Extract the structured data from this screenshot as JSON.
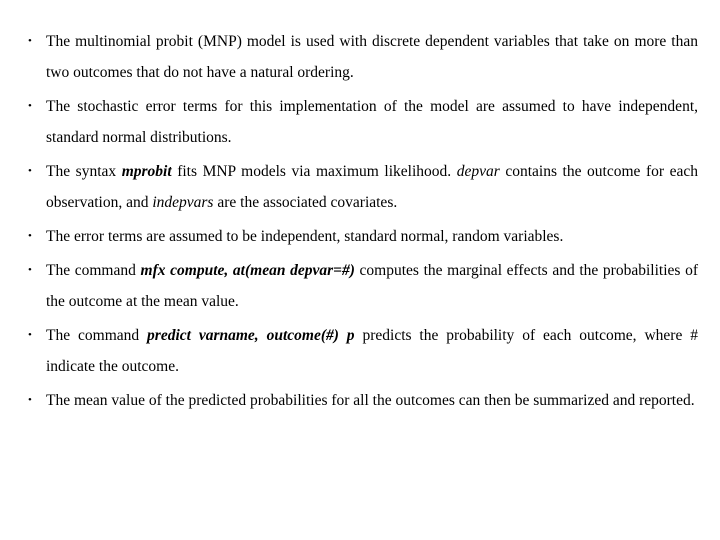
{
  "bullet_glyph": "•",
  "bullets": [
    {
      "parts": [
        {
          "text": "The multinomial probit (MNP) model is used with discrete dependent variables that take on more than two outcomes that do not have a natural ordering.",
          "style": "normal"
        }
      ]
    },
    {
      "parts": [
        {
          "text": "The stochastic error terms for this implementation of the model are assumed to have independent, standard normal distributions.",
          "style": "normal"
        }
      ]
    },
    {
      "parts": [
        {
          "text": "The syntax ",
          "style": "normal"
        },
        {
          "text": "mprobit",
          "style": "bold-italic"
        },
        {
          "text": " fits MNP models via maximum likelihood. ",
          "style": "normal"
        },
        {
          "text": "depvar",
          "style": "italic"
        },
        {
          "text": " contains the outcome for each observation, and ",
          "style": "normal"
        },
        {
          "text": "indepvars",
          "style": "italic"
        },
        {
          "text": " are the associated covariates.",
          "style": "normal"
        }
      ]
    },
    {
      "parts": [
        {
          "text": "The error terms  are assumed to be independent, standard normal, random variables.",
          "style": "normal"
        }
      ]
    },
    {
      "parts": [
        {
          "text": "The command ",
          "style": "normal"
        },
        {
          "text": "mfx compute, at(mean depvar=#)",
          "style": "bold-italic"
        },
        {
          "text": " computes the marginal effects and the probabilities of the outcome at the mean value.",
          "style": "normal"
        }
      ]
    },
    {
      "parts": [
        {
          "text": "The command ",
          "style": "normal"
        },
        {
          "text": "predict varname, outcome(#) p",
          "style": "bold-italic"
        },
        {
          "text": " predicts the probability of each outcome, where # indicate the outcome.",
          "style": "normal"
        }
      ]
    },
    {
      "parts": [
        {
          "text": "The mean value of the predicted probabilities for all the outcomes can then be summarized and reported.",
          "style": "normal"
        }
      ]
    }
  ]
}
